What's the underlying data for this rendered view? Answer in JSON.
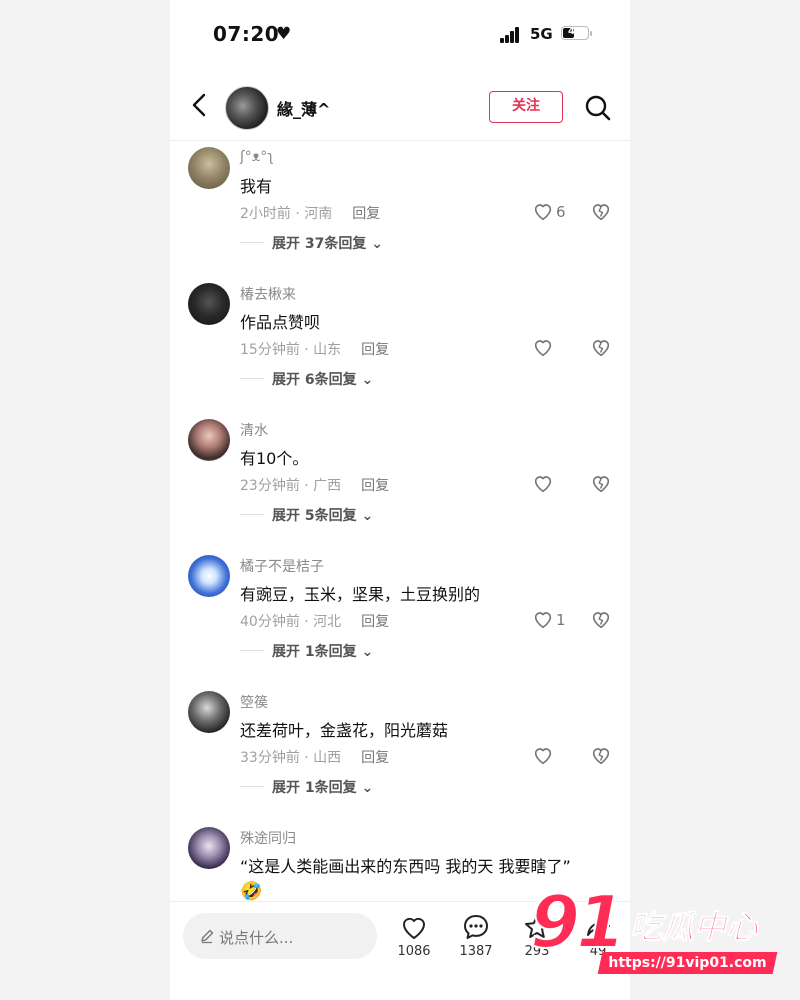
{
  "status_bar": {
    "time": "07:20",
    "network": "5G",
    "battery": "49",
    "battery_level": 0.49
  },
  "header": {
    "username": "緣_薄^",
    "follow_label": "关注"
  },
  "comments": [
    {
      "name": "ʃ°ᴥ°ʅ",
      "text": "我有",
      "meta": "2小时前 · 河南",
      "reply": "回复",
      "likes": "6",
      "expand": "展开 37条回复"
    },
    {
      "name": "椿去楸来",
      "text": "作品点赞呗",
      "meta": "15分钟前 · 山东",
      "reply": "回复",
      "likes": "",
      "expand": "展开 6条回复"
    },
    {
      "name": "清水",
      "text": "有10个。",
      "meta": "23分钟前 · 广西",
      "reply": "回复",
      "likes": "",
      "expand": "展开 5条回复"
    },
    {
      "name": "橘子不是桔子",
      "text": "有豌豆，玉米，坚果，土豆换别的",
      "meta": "40分钟前 · 河北",
      "reply": "回复",
      "likes": "1",
      "expand": "展开 1条回复"
    },
    {
      "name": "箜篌",
      "text": "还差荷叶，金盏花，阳光蘑菇",
      "meta": "33分钟前 · 山西",
      "reply": "回复",
      "likes": "",
      "expand": "展开 1条回复"
    },
    {
      "name": "殊途同归",
      "text": "“这是人类能画出来的东西吗 我的天 我要瞎了”",
      "emoji": "🤣"
    }
  ],
  "bottom_bar": {
    "input_placeholder": "说点什么...",
    "likes": "1086",
    "comments": "1387",
    "favorites": "293",
    "shares": "49"
  },
  "watermark": {
    "brand_number": "91",
    "brand_text": "吃瓜中心",
    "url": "https://91vip01.com"
  },
  "colors": {
    "accent": "#e33355",
    "watermark": "#ff2d55"
  },
  "icons": [
    "back-icon",
    "search-icon",
    "heart-icon",
    "broken-heart-icon",
    "chevron-down-icon",
    "pencil-icon",
    "comment-icon",
    "star-icon",
    "share-icon"
  ]
}
